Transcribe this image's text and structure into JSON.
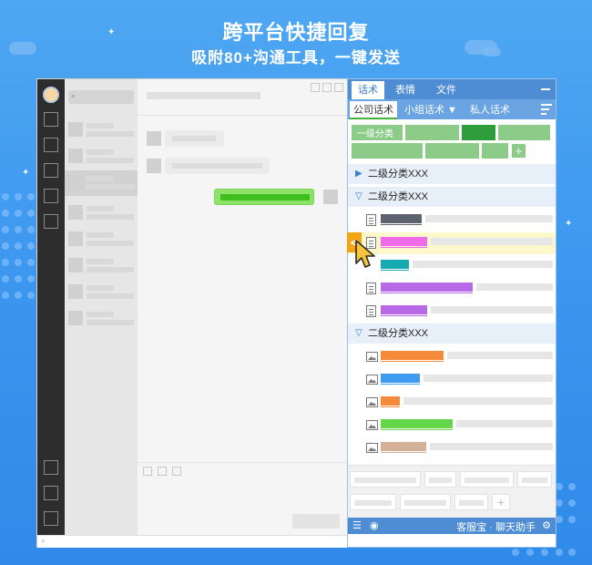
{
  "headline": {
    "title": "跨平台快捷回复",
    "subtitle": "吸附80+沟通工具，一键发送"
  },
  "chat_window": {
    "search_icon": "search-icon",
    "footer_search_icon": "search-icon"
  },
  "panel": {
    "tabs": [
      "话术",
      "表情",
      "文件"
    ],
    "active_tab": "话术",
    "subtabs": [
      "公司话术",
      "小组话术 ▼",
      "私人话术"
    ],
    "active_subtab": "公司话术",
    "first_category": "一级分类",
    "add_label": "+",
    "groups": [
      {
        "label": "二级分类XXX",
        "expanded": false
      },
      {
        "label": "二级分类XXX",
        "expanded": true
      },
      {
        "label": "二级分类XXX",
        "expanded": true
      }
    ],
    "arrow_glyph": "<",
    "footer": {
      "label": "客服宝 · 聊天助手",
      "list_icon": "list-icon",
      "eye_icon": "eye-icon",
      "settings_icon": "gear-icon"
    },
    "colors": {
      "accent": "#4e8dd4",
      "category_green": "#8dcc88",
      "category_selected": "#2f9d3b",
      "highlight": "#fcf8cc",
      "send_arrow": "#f5a416"
    },
    "text_rows": [
      {
        "bar_color": "#5c6270"
      },
      {
        "bar_color": "#f06bea"
      },
      {
        "bar_color": "#17aab1"
      },
      {
        "bar_color": "#b769e6"
      },
      {
        "bar_color": "#b769e6"
      }
    ],
    "image_rows": [
      {
        "bar_color": "#f58a3a"
      },
      {
        "bar_color": "#3e9bf0"
      },
      {
        "bar_color": "#f58a3a"
      },
      {
        "bar_color": "#63d64a"
      },
      {
        "bar_color": "#d4b097"
      }
    ]
  }
}
